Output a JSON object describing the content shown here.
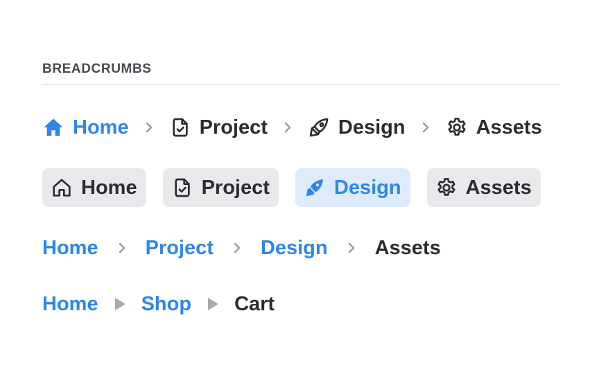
{
  "section": {
    "title": "BREADCRUMBS"
  },
  "row1": {
    "items": [
      "Home",
      "Project",
      "Design",
      "Assets"
    ]
  },
  "row2": {
    "items": [
      "Home",
      "Project",
      "Design",
      "Assets"
    ],
    "active_index": 2
  },
  "row3": {
    "items": [
      "Home",
      "Project",
      "Design",
      "Assets"
    ]
  },
  "row4": {
    "items": [
      "Home",
      "Shop",
      "Cart"
    ]
  },
  "icons": {
    "home": "home-icon",
    "project": "file-check-icon",
    "design": "pen-nib-icon",
    "assets": "gear-icon",
    "separator": "chevron-right-icon",
    "separator_alt": "triangle-right-icon"
  },
  "colors": {
    "link": "#2e86ea",
    "text": "#2b2b31",
    "separator": "#9b9ba2",
    "pill_bg": "#e9e9ec",
    "pill_active_bg": "#ddebfd"
  }
}
